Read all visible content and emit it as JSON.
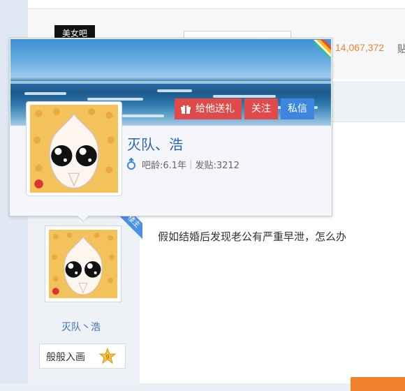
{
  "forum": {
    "logo_text": "美女吧",
    "member_count": "14,067,372",
    "member_suffix": "贴"
  },
  "popup": {
    "username": "灭队、浩",
    "gift_label": "给他送礼",
    "follow_label": "关注",
    "message_label": "私信",
    "tenure_label": "吧龄:6.1年",
    "posts_label": "发贴:3212",
    "gender": "male",
    "icons": {
      "gift": "gift-icon",
      "gender": "male-gender-icon",
      "corner": "color-corner-badge-icon"
    }
  },
  "post": {
    "title_text": "假如结婚后发现老公有严重早泄，怎么办",
    "louzhu_badge": "楼主",
    "author_name": "灭队丶浩",
    "level_label": "般般入画",
    "level_icon": "star-level-icon"
  },
  "colors": {
    "accent_red": "#e04a4a",
    "accent_blue": "#3d86e0",
    "count_orange": "#f0822d",
    "link_blue": "#3a6fb3"
  }
}
